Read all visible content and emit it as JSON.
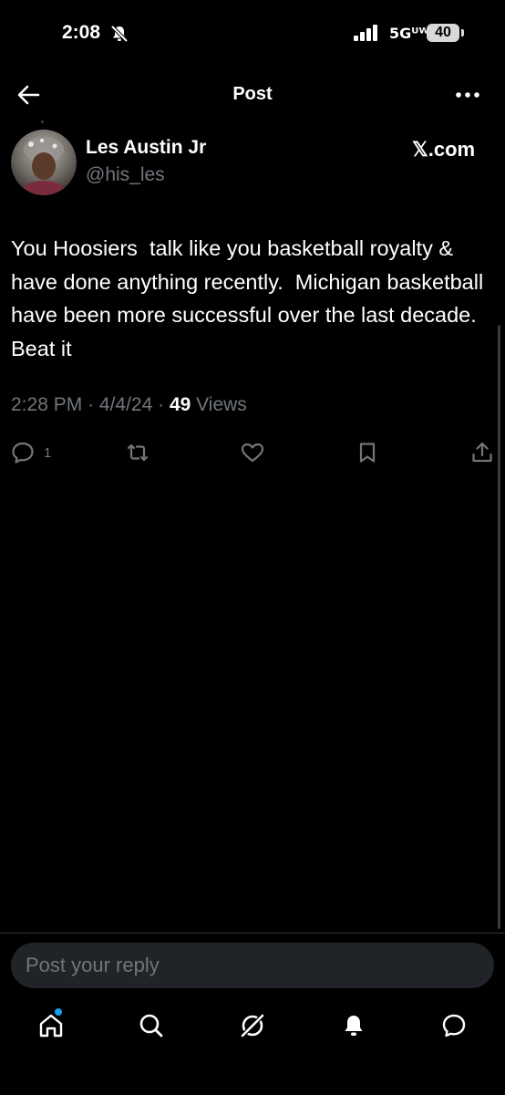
{
  "status_bar": {
    "time": "2:08",
    "network": "5Gᵁᵂ",
    "battery": "40"
  },
  "header": {
    "title": "Post"
  },
  "post": {
    "author_name": "Les Austin Jr",
    "author_handle": "@his_les",
    "source": "𝕏.com",
    "text": "You Hoosiers  talk like you basketball royalty & have done anything recently.  Michigan basketball have been more successful over the last decade.   Beat it",
    "time": "2:28 PM",
    "date": "4/4/24",
    "views_count": "49",
    "views_label": "Views",
    "reply_count": "1"
  },
  "composer": {
    "placeholder": "Post your reply"
  },
  "colors": {
    "background": "#000000",
    "muted_text": "#71767b",
    "accent": "#1d9bf0",
    "reply_box_bg": "#202327"
  },
  "icons": {
    "back": "arrow-left-icon",
    "more": "more-dots-icon",
    "reply": "comment-icon",
    "repost": "repost-icon",
    "like": "heart-icon",
    "bookmark": "bookmark-icon",
    "share": "share-icon",
    "nav": [
      "home-icon",
      "search-icon",
      "grok-icon",
      "bell-icon",
      "messages-icon"
    ]
  }
}
